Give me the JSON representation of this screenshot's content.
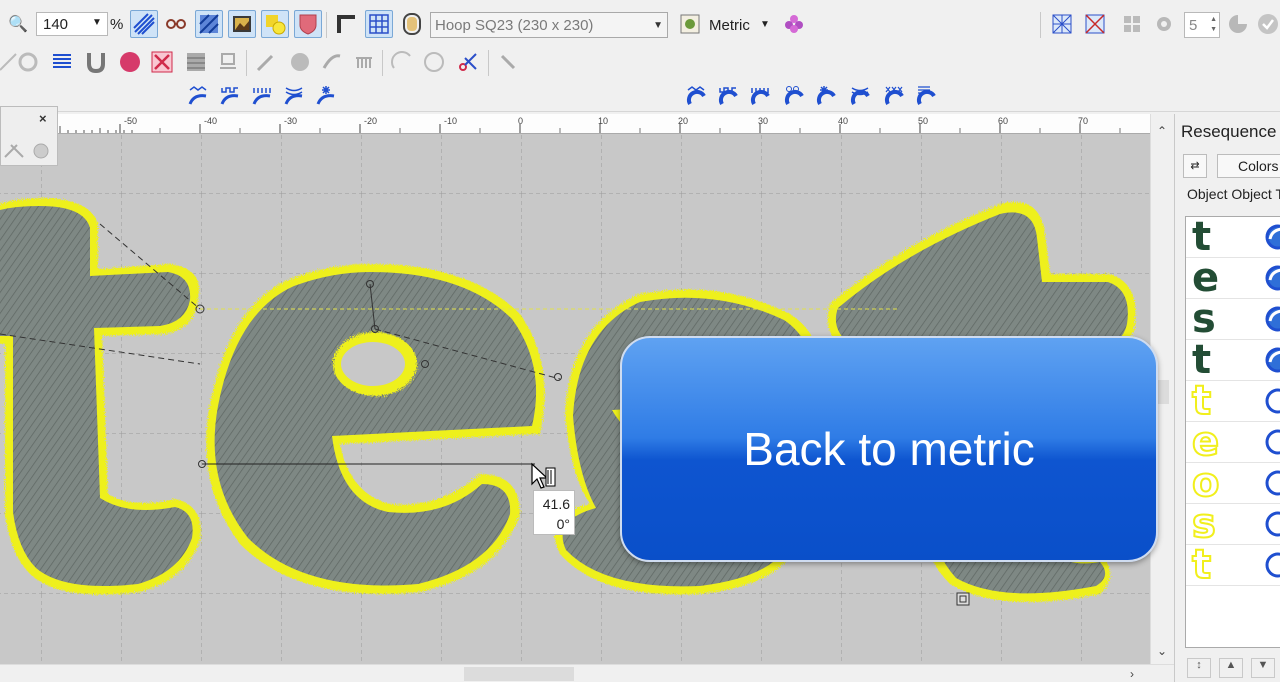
{
  "toolbar": {
    "zoom_value": "140",
    "zoom_unit": "%",
    "hoop_select": "Hoop SQ23 (230 x 230)",
    "units": "Metric",
    "count_value": "5"
  },
  "ruler": {
    "ticks": [
      "-50",
      "-40",
      "-30",
      "-20",
      "-10",
      "0",
      "10",
      "20",
      "30",
      "40",
      "50",
      "60",
      "70"
    ]
  },
  "mini_panel": {
    "close_glyph": "×"
  },
  "right_panel": {
    "title": "Resequence",
    "colors_button": "Colors",
    "column_headers": "Object Object T",
    "items": [
      {
        "letter": "t",
        "style": "green"
      },
      {
        "letter": "e",
        "style": "green"
      },
      {
        "letter": "s",
        "style": "green"
      },
      {
        "letter": "t",
        "style": "green"
      },
      {
        "letter": "t",
        "style": "yellow"
      },
      {
        "letter": "e",
        "style": "yellow"
      },
      {
        "letter": "o",
        "style": "yellow"
      },
      {
        "letter": "s",
        "style": "yellow"
      },
      {
        "letter": "t",
        "style": "yellow"
      }
    ]
  },
  "tooltip": {
    "length": "41.6",
    "angle": "0°"
  },
  "banner": {
    "text": "Back to metric"
  },
  "colors": {
    "fill": "#7d8784",
    "outline": "#eef01f",
    "banner_top": "#5fa2f2",
    "banner_bottom": "#0a4fc9"
  }
}
